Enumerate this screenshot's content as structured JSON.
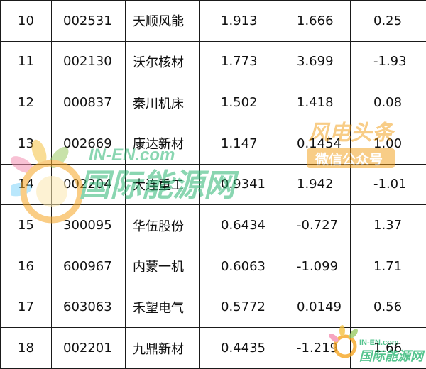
{
  "rows": [
    {
      "rank": "10",
      "code": "002531",
      "name": "天顺风能",
      "v1": "1.913",
      "v2": "1.666",
      "v3": "0.25"
    },
    {
      "rank": "11",
      "code": "002130",
      "name": "沃尔核材",
      "v1": "1.773",
      "v2": "3.699",
      "v3": "-1.93"
    },
    {
      "rank": "12",
      "code": "000837",
      "name": "秦川机床",
      "v1": "1.502",
      "v2": "1.418",
      "v3": "0.08"
    },
    {
      "rank": "13",
      "code": "002669",
      "name": "康达新材",
      "v1": "1.147",
      "v2": "0.1454",
      "v3": "1.00"
    },
    {
      "rank": "14",
      "code": "002204",
      "name": "大连重工",
      "v1": "0.9341",
      "v2": "1.942",
      "v3": "-1.01"
    },
    {
      "rank": "15",
      "code": "300095",
      "name": "华伍股份",
      "v1": "0.6434",
      "v2": "-0.727",
      "v3": "1.37"
    },
    {
      "rank": "16",
      "code": "600967",
      "name": "内蒙一机",
      "v1": "0.6063",
      "v2": "-1.099",
      "v3": "1.71"
    },
    {
      "rank": "17",
      "code": "603063",
      "name": "禾望电气",
      "v1": "0.5772",
      "v2": "0.0149",
      "v3": "0.56"
    },
    {
      "rank": "18",
      "code": "002201",
      "name": "九鼎新材",
      "v1": "0.4435",
      "v2": "-1.219",
      "v3": "1.66"
    }
  ],
  "watermarks": {
    "main_en": "IN-EN.com",
    "main_cn": "国际能源网",
    "badge_top": "风电头条",
    "badge_bottom": "微信公众号",
    "corner_en": "IN-EN.com",
    "corner_cn": "国际能源网"
  },
  "colors": {
    "border": "#1a1a1a",
    "text": "#111111",
    "watermark_green": "#2bb673",
    "watermark_orange": "#f39c12",
    "watermark_red": "#e74c3c"
  }
}
